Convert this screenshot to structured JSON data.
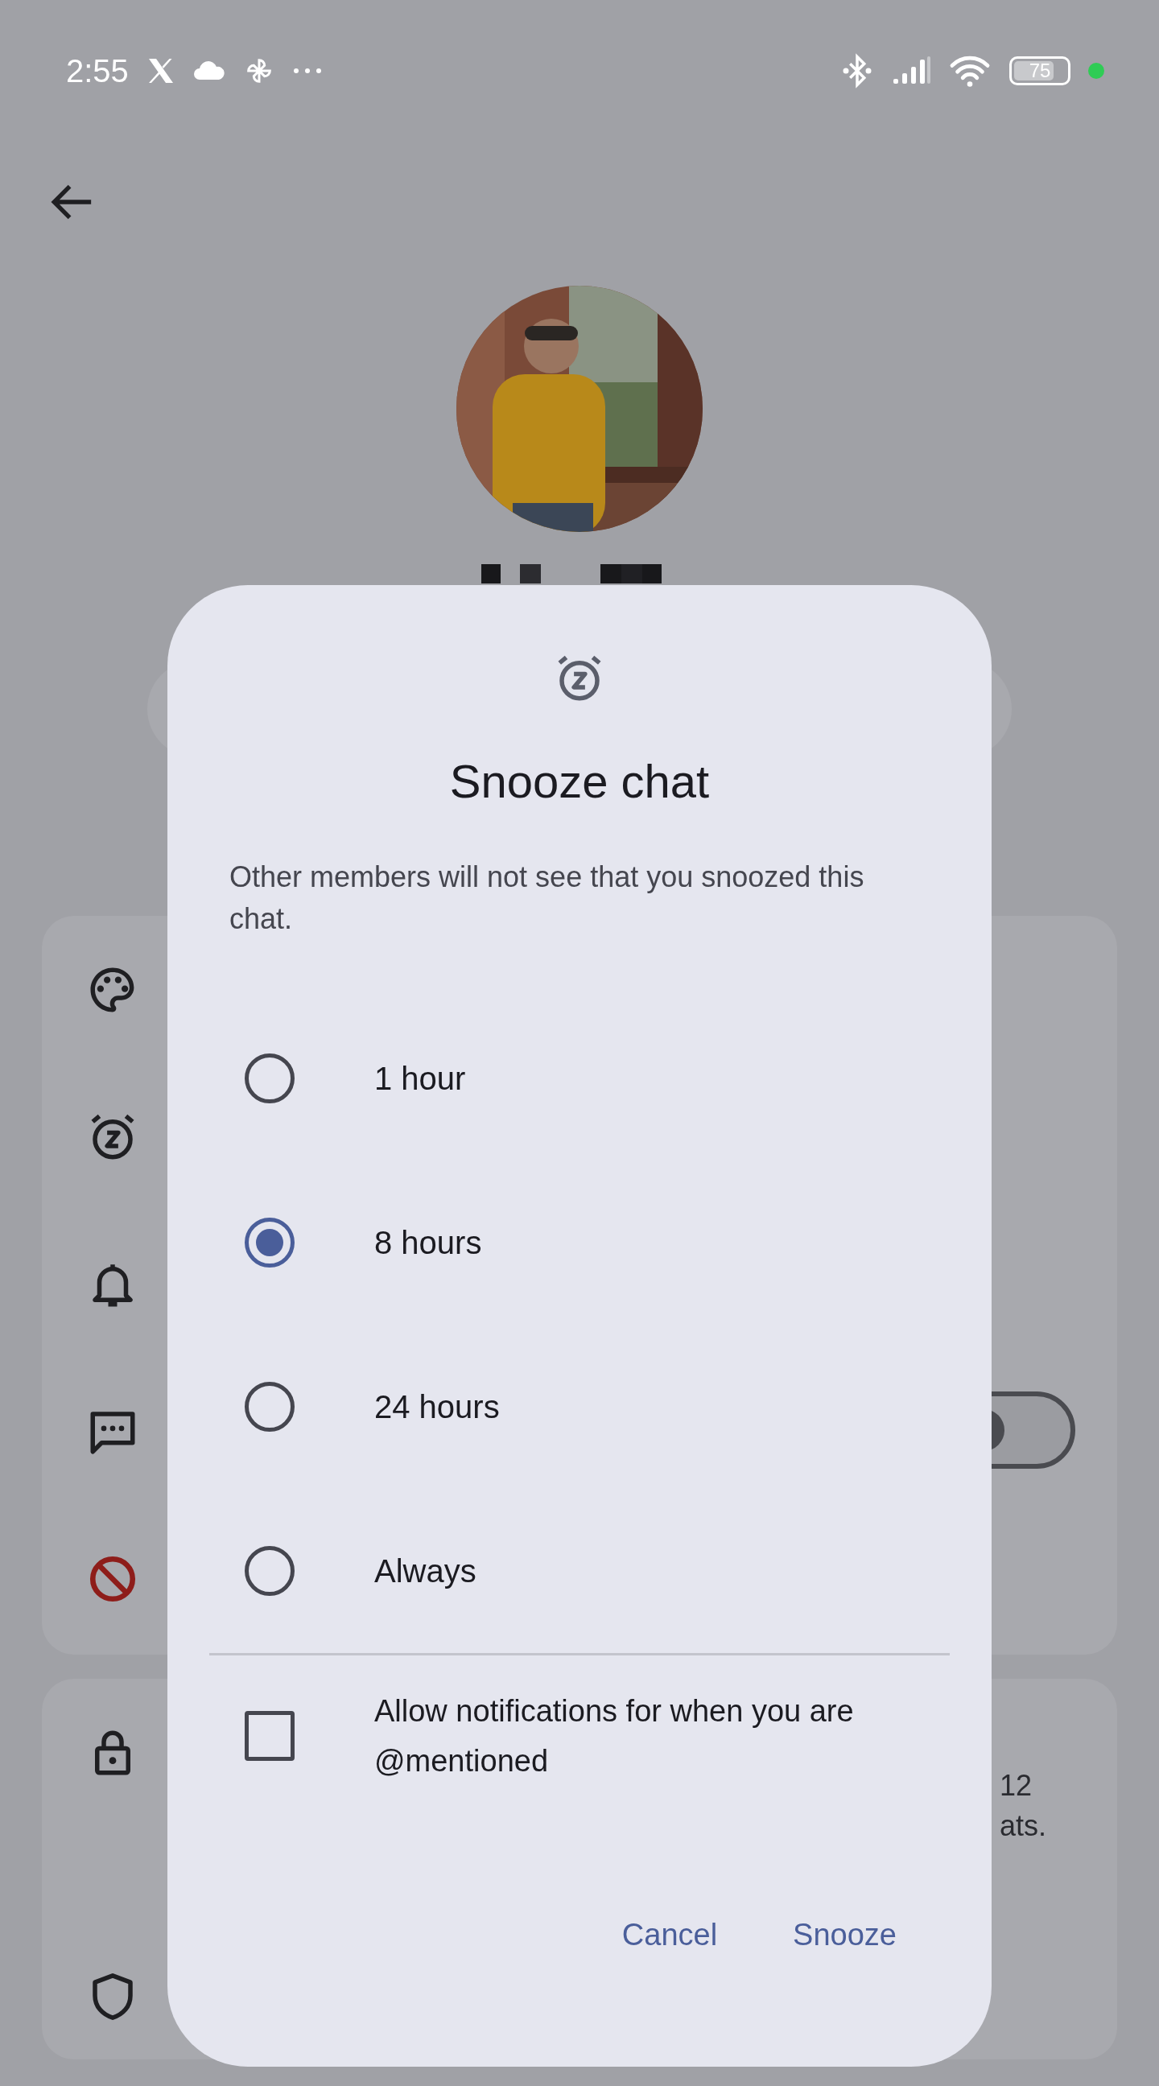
{
  "status_bar": {
    "time": "2:55",
    "battery": "75"
  },
  "settings": {
    "group_1": [
      {
        "kind": "palette"
      },
      {
        "kind": "snooze"
      },
      {
        "kind": "bell"
      },
      {
        "kind": "chat",
        "toggle_on": false
      },
      {
        "kind": "block"
      }
    ],
    "group_2": [
      {
        "kind": "lock",
        "text_lines": [
          "12",
          "ats."
        ]
      },
      {
        "kind": "shield"
      }
    ]
  },
  "dialog": {
    "title": "Snooze chat",
    "description": "Other members will not see that you snoozed this chat.",
    "options": [
      {
        "label": "1 hour",
        "selected": false
      },
      {
        "label": "8 hours",
        "selected": true
      },
      {
        "label": "24 hours",
        "selected": false
      },
      {
        "label": "Always",
        "selected": false
      }
    ],
    "mention_checkbox": {
      "label": "Allow notifications for when you are @mentioned",
      "checked": false
    },
    "buttons": [
      {
        "label": "Cancel"
      },
      {
        "label": "Snooze"
      }
    ]
  }
}
